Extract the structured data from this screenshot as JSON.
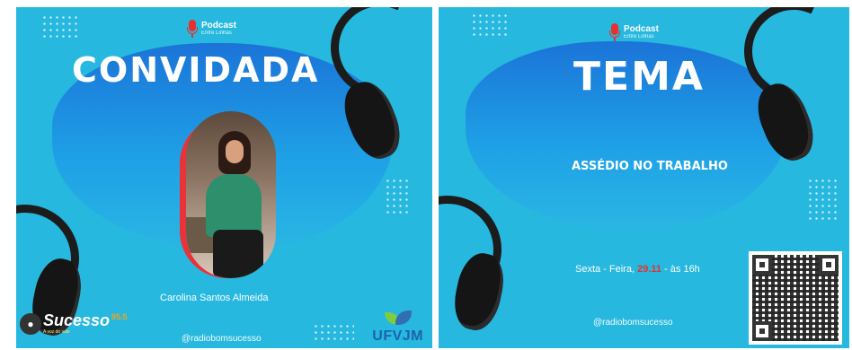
{
  "left_panel": {
    "podcast_logo": {
      "title": "Podcast",
      "subtitle": "Entre Linhas"
    },
    "heading": "CONVIDADA",
    "guest_name": "Carolina Santos Almeida",
    "handle": "@radiobomsucesso",
    "station_logo": {
      "name": "Sucesso",
      "freq": "95.5",
      "tagline": "A voz do vale"
    },
    "partner_logo": "UFVJM"
  },
  "right_panel": {
    "podcast_logo": {
      "title": "Podcast",
      "subtitle": "Entre Linhas"
    },
    "heading": "TEMA",
    "topic": "ASSÉDIO NO TRABALHO",
    "schedule": {
      "prefix": "Sexta - Feira, ",
      "date": "29.11",
      "suffix": " - às 16h"
    },
    "handle": "@radiobomsucesso",
    "qr_icon": "qr-code-icon"
  },
  "colors": {
    "background": "#26b8de",
    "blob": "#1b74d8",
    "accent": "#e5322d",
    "text": "#ffffff"
  }
}
